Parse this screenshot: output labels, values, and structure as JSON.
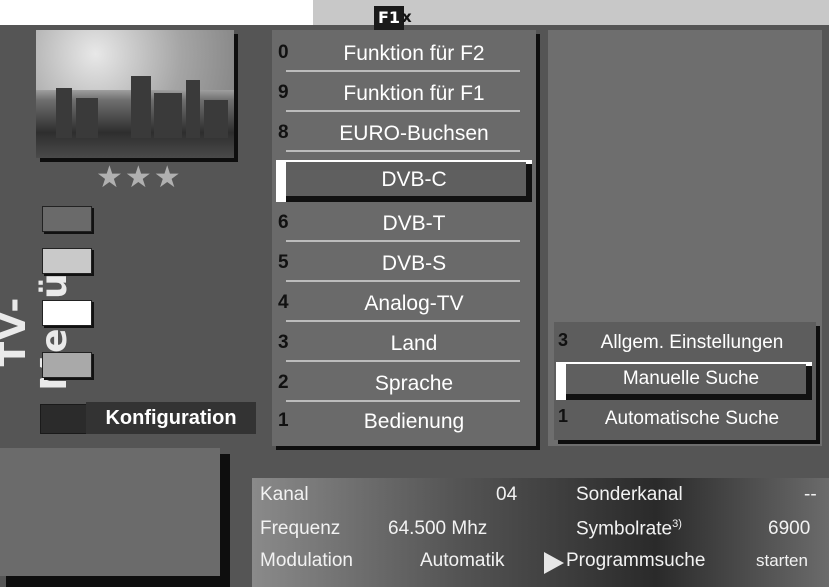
{
  "hotkey": {
    "label": "F1",
    "close_glyph": "x"
  },
  "sidebar": {
    "title": "TV-Menü",
    "rating_stars": "★★★",
    "section_label": "Konfiguration",
    "color_keys": [
      "red-key-icon",
      "green-key-icon",
      "yellow-key-icon",
      "blue-key-icon"
    ]
  },
  "main_menu": {
    "items": [
      {
        "num": "0",
        "label": "Funktion für F2"
      },
      {
        "num": "9",
        "label": "Funktion für F1"
      },
      {
        "num": "8",
        "label": "EURO-Buchsen"
      },
      {
        "num": "",
        "label": "DVB-C",
        "selected": true
      },
      {
        "num": "6",
        "label": "DVB-T"
      },
      {
        "num": "5",
        "label": "DVB-S"
      },
      {
        "num": "4",
        "label": "Analog-TV"
      },
      {
        "num": "3",
        "label": "Land"
      },
      {
        "num": "2",
        "label": "Sprache"
      },
      {
        "num": "1",
        "label": "Bedienung"
      }
    ]
  },
  "sub_menu": {
    "items": [
      {
        "num": "3",
        "label": "Allgem. Einstellungen"
      },
      {
        "num": "2",
        "label": "Manuelle Suche",
        "selected": true
      },
      {
        "num": "1",
        "label": "Automatische Suche"
      }
    ]
  },
  "info_panel": {
    "kanal_label": "Kanal",
    "kanal_value": "04",
    "sonderkanal_label": "Sonderkanal",
    "sonderkanal_value": "--",
    "frequenz_label": "Frequenz",
    "frequenz_value": "64.500 Mhz",
    "symbolrate_label": "Symbolrate",
    "symbolrate_sup": "3)",
    "symbolrate_value": "6900",
    "modulation_label": "Modulation",
    "modulation_value": "Automatik",
    "programmsuche_label": "Programmsuche",
    "programmsuche_action": "starten"
  }
}
